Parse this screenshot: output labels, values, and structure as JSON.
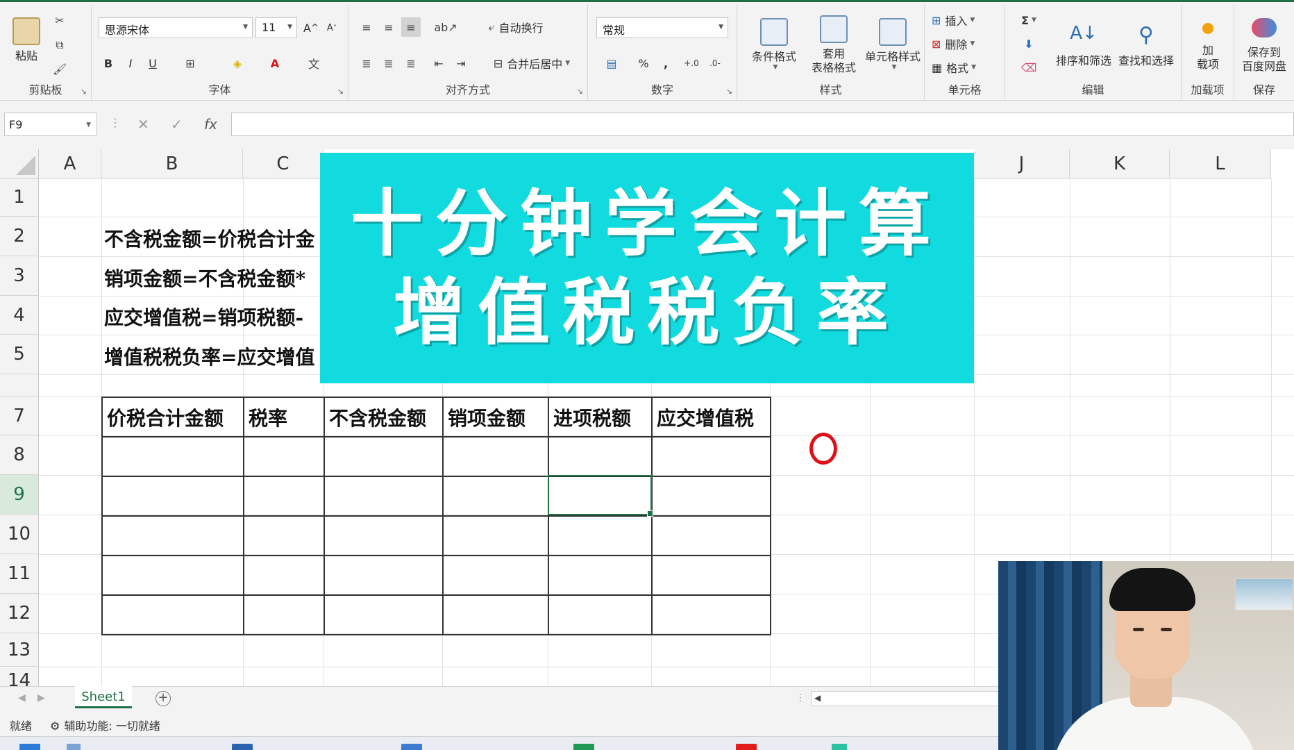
{
  "ribbon": {
    "clipboard": {
      "label": "剪贴板",
      "paste": "粘贴"
    },
    "font": {
      "label": "字体",
      "name": "思源宋体",
      "size": "11",
      "bold": "B",
      "italic": "I",
      "underline": "U",
      "grow": "A",
      "shrink": "A"
    },
    "alignment": {
      "label": "对齐方式",
      "wrap": "自动换行",
      "merge": "合并后居中"
    },
    "number": {
      "label": "数字",
      "format": "常规",
      "percent": "%",
      "comma": ","
    },
    "styles": {
      "label": "样式",
      "conditional": "条件格式",
      "table_line1": "套用",
      "table_line2": "表格格式",
      "cell_styles": "单元格样式"
    },
    "cells": {
      "label": "单元格",
      "insert": "插入",
      "delete": "删除",
      "format": "格式"
    },
    "editing": {
      "label": "编辑",
      "sigma": "Σ",
      "sort": "排序和筛选",
      "find": "查找和选择"
    },
    "addins": {
      "label": "加载项",
      "line1": "加",
      "line2": "载项"
    },
    "save": {
      "label": "保存",
      "line1": "保存到",
      "line2": "百度网盘"
    }
  },
  "formula_bar": {
    "name_box": "F9",
    "cancel": "✕",
    "enter": "✓",
    "fx": "fx",
    "value": ""
  },
  "columns": [
    "A",
    "B",
    "C",
    "J",
    "K",
    "L"
  ],
  "rows": [
    "1",
    "2",
    "3",
    "4",
    "5",
    "7",
    "8",
    "9",
    "10",
    "11",
    "12",
    "13",
    "14"
  ],
  "active_row": "9",
  "cells": {
    "b2": "不含税金额=价税合计金",
    "b3": "销项金额=不含税金额*",
    "b4": "应交增值税=销项税额-",
    "b5": "增值税税负率=应交增值"
  },
  "table": {
    "headers": [
      "价税合计金额",
      "税率",
      "不含税金额",
      "销项金额",
      "进项税额",
      "应交增值税"
    ],
    "rows": 5
  },
  "banner": {
    "line1": "十分钟学会计算",
    "line2": "增值税税负率",
    "color": "#12dbe0"
  },
  "sheet_tabs": {
    "active": "Sheet1"
  },
  "status": {
    "ready": "就绪",
    "accessibility": "辅助功能: 一切就绪"
  },
  "colors": {
    "accent": "#1e7145",
    "selection": "#217346",
    "annotation": "#e0101a"
  }
}
